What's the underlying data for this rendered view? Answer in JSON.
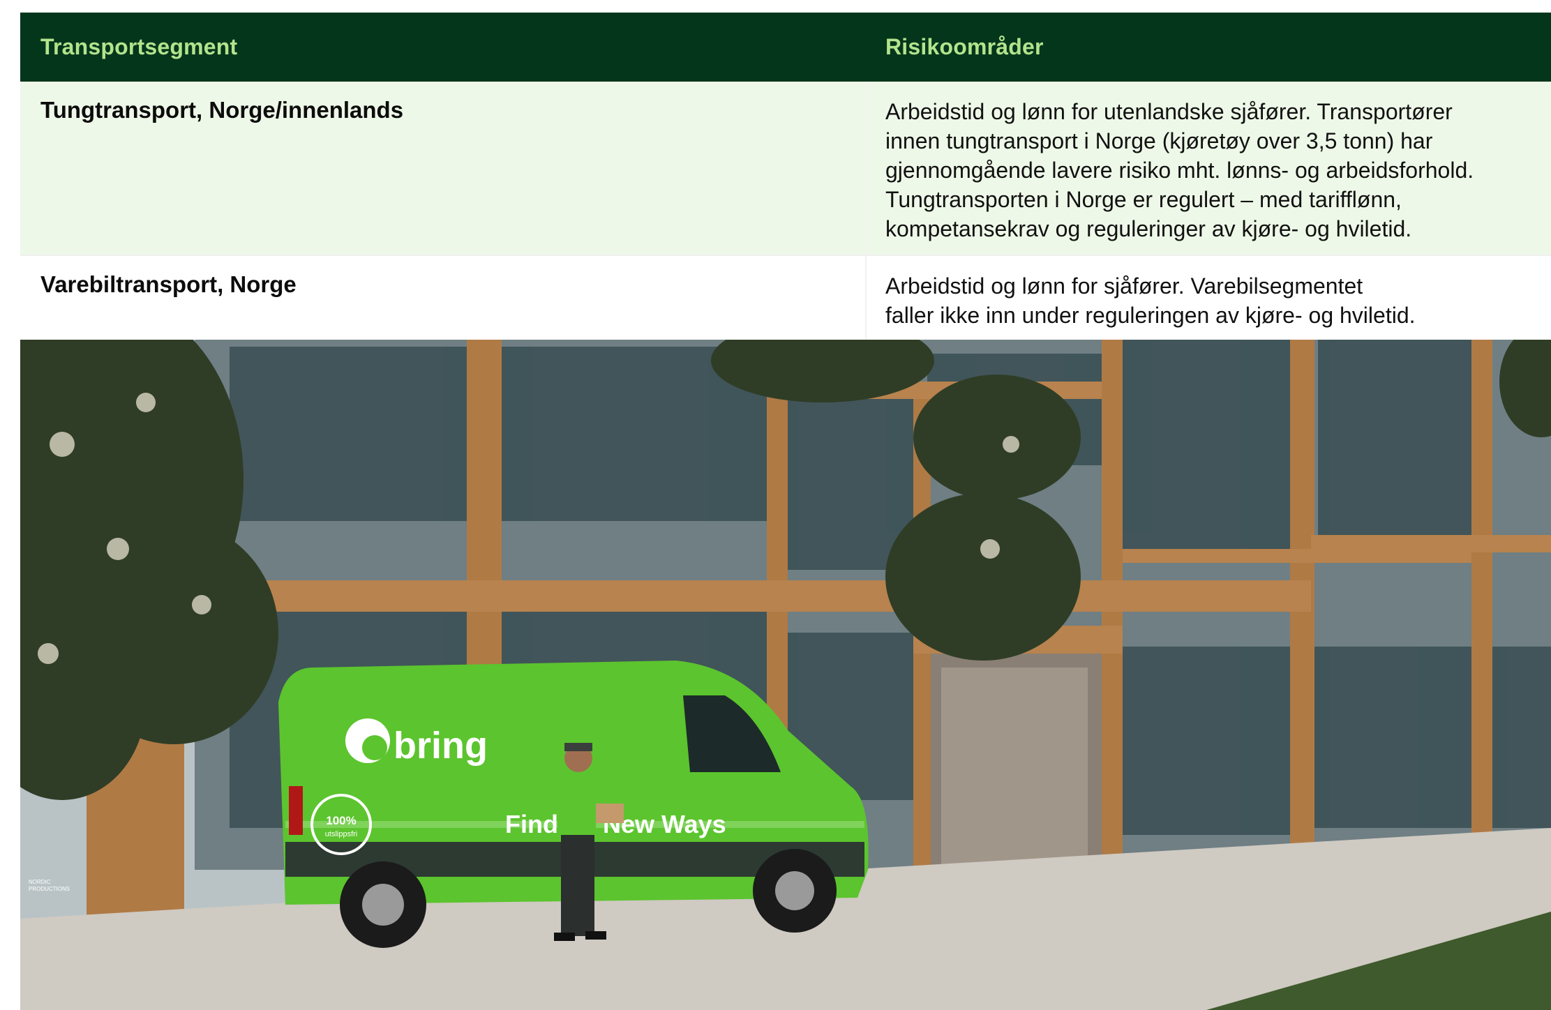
{
  "table": {
    "headers": [
      "Transportsegment",
      "Risikoområder"
    ],
    "rows": [
      {
        "segment": "Tungtransport, Norge/innenlands",
        "risk_lines": [
          "Arbeidstid og lønn for utenlandske sjåfører. Transportører",
          "innen tungtransport i Norge (kjøretøy over 3,5 tonn) har",
          "gjennomgående lavere risiko mht. lønns- og arbeidsforhold.",
          "Tungtransporten i Norge er regulert – med tarifflønn,",
          "kompetansekrav og reguleringer av kjøre- og hviletid."
        ]
      },
      {
        "segment": "Varebiltransport, Norge",
        "risk_lines": [
          "Arbeidstid og lønn for sjåfører. Varebilsegmentet",
          "faller ikke inn under reguleringen av kjøre- og hviletid."
        ]
      }
    ]
  },
  "photo": {
    "van_brand": "bring",
    "van_slogan": "Finding New Ways",
    "van_badge_top": "100%",
    "van_badge_bottom": "utslippsfri",
    "watermark_line1": "NORDIC",
    "watermark_line2": "PRODUCTIONS"
  },
  "colors": {
    "header_bg": "#04361b",
    "header_text": "#b3e48d",
    "row_tint": "#eef8e8",
    "van_green": "#5cc42e"
  }
}
